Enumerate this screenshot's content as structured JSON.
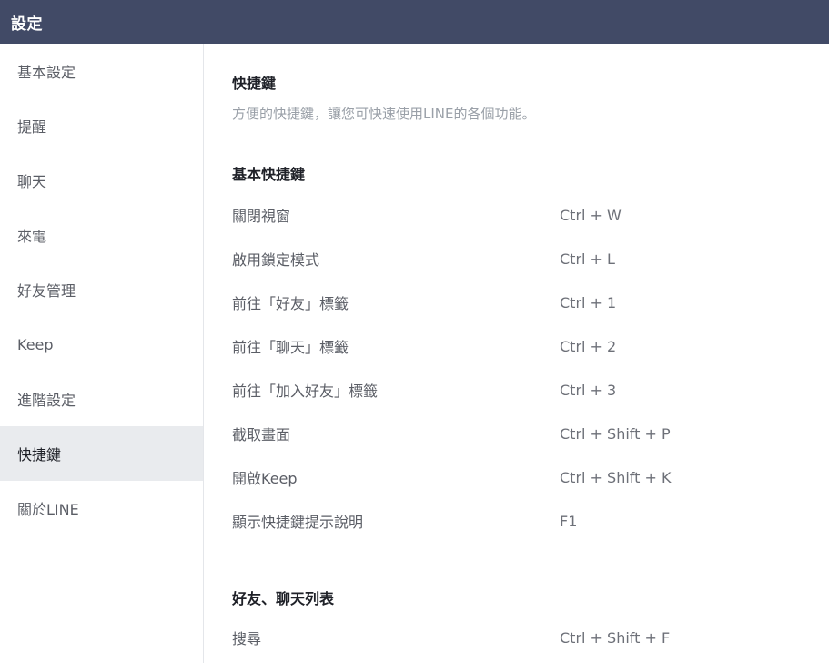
{
  "window": {
    "title": "設定"
  },
  "sidebar": {
    "items": [
      {
        "label": "基本設定"
      },
      {
        "label": "提醒"
      },
      {
        "label": "聊天"
      },
      {
        "label": "來電"
      },
      {
        "label": "好友管理"
      },
      {
        "label": "Keep"
      },
      {
        "label": "進階設定"
      },
      {
        "label": "快捷鍵",
        "active": true
      },
      {
        "label": "關於LINE"
      }
    ]
  },
  "main": {
    "title": "快捷鍵",
    "subtitle": "方便的快捷鍵，讓您可快速使用LINE的各個功能。",
    "sections": [
      {
        "title": "基本快捷鍵",
        "rows": [
          {
            "action": "關閉視窗",
            "keys": "Ctrl + W"
          },
          {
            "action": "啟用鎖定模式",
            "keys": "Ctrl + L"
          },
          {
            "action": "前往「好友」標籤",
            "keys": "Ctrl + 1"
          },
          {
            "action": "前往「聊天」標籤",
            "keys": "Ctrl + 2"
          },
          {
            "action": "前往「加入好友」標籤",
            "keys": "Ctrl + 3"
          },
          {
            "action": "截取畫面",
            "keys": "Ctrl + Shift + P"
          },
          {
            "action": "開啟Keep",
            "keys": "Ctrl + Shift + K"
          },
          {
            "action": "顯示快捷鍵提示說明",
            "keys": "F1"
          }
        ]
      },
      {
        "title": "好友、聊天列表",
        "rows": [
          {
            "action": "搜尋",
            "keys": "Ctrl + Shift + F"
          }
        ]
      }
    ]
  },
  "colors": {
    "titlebar": "#414a66",
    "sidebar_active": "#e9ebee",
    "muted_text": "#9aa0a8"
  }
}
